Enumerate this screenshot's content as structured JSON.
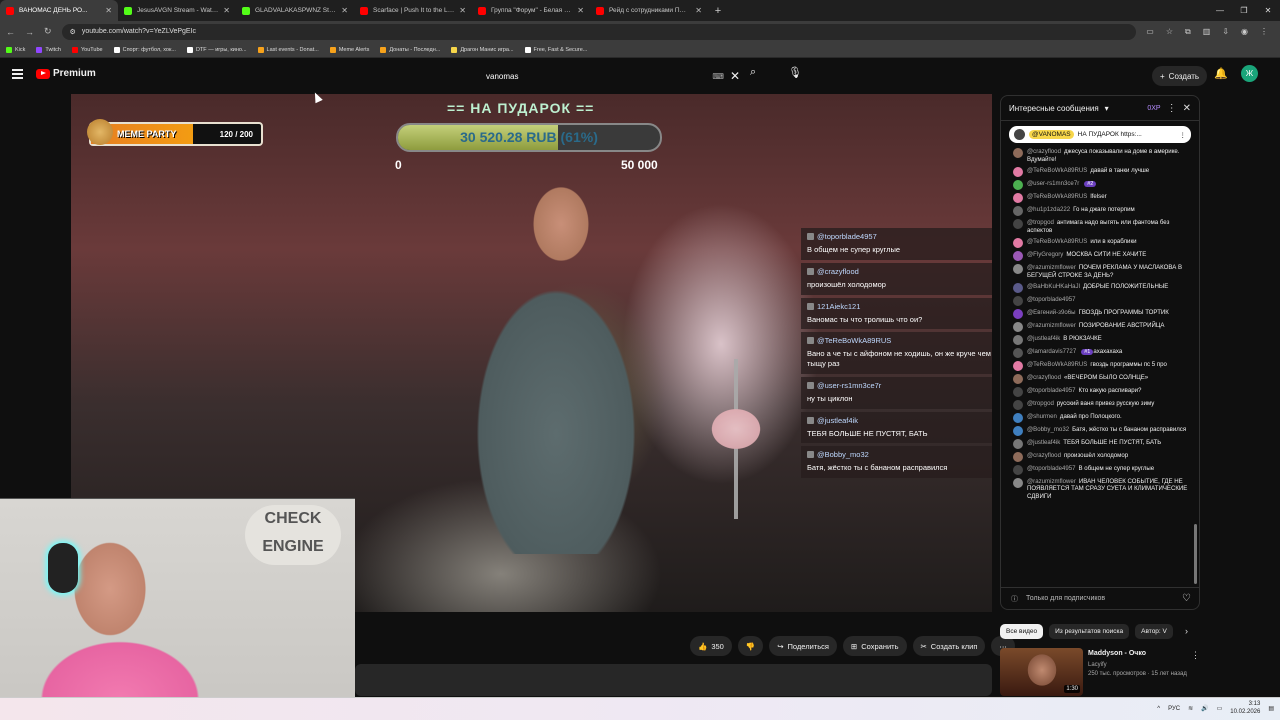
{
  "browser": {
    "tabs": [
      {
        "title": "ВАНОМАС ДЕНЬ РО...",
        "fav_color": "#ff0000",
        "active": true
      },
      {
        "title": "JesusAVGN Stream - Watch Live",
        "fav_color": "#53fc18",
        "active": false
      },
      {
        "title": "GLADVALAKASPWNZ Stream",
        "fav_color": "#53fc18",
        "active": false
      },
      {
        "title": "Scarface | Push It to the Limit",
        "fav_color": "#ff0000",
        "active": false
      },
      {
        "title": "Группа \"Форум\" - Белая ноч",
        "fav_color": "#ff0000",
        "active": false
      },
      {
        "title": "Рейд с сотрудниками ППСП",
        "fav_color": "#ff0000",
        "active": false
      }
    ],
    "url": "youtube.com/watch?v=YeZLVePgEIc",
    "bookmarks": [
      {
        "label": "Kick",
        "color": "#53fc18"
      },
      {
        "label": "Twitch",
        "color": "#9146ff"
      },
      {
        "label": "YouTube",
        "color": "#ff0000"
      },
      {
        "label": "Спорт: футбол, хок...",
        "color": "#ffffff"
      },
      {
        "label": "DTF — игры, кино...",
        "color": "#ffffff"
      },
      {
        "label": "Last events - Donat...",
        "color": "#f7a21b"
      },
      {
        "label": "Meme Alerts",
        "color": "#f7a21b"
      },
      {
        "label": "Донаты - Последн...",
        "color": "#f7a21b"
      },
      {
        "label": "Драгон Манис игра...",
        "color": "#f7d64a"
      },
      {
        "label": "Free, Fast & Secure...",
        "color": "#ffffff"
      }
    ]
  },
  "yt": {
    "logo_text": "Premium",
    "search_value": "vanomas",
    "create_label": "Создать",
    "avatar_letter": "Ж"
  },
  "video": {
    "meme_party": {
      "label": "MEME PARTY",
      "counter": "120 / 200",
      "progress": 0.6
    },
    "donation": {
      "title": "== НА ПУДАРОК ==",
      "amount": "30 520.28 RUB (61%)",
      "progress": 0.61,
      "min": "0",
      "max": "50 000"
    },
    "sign_text": "CHECK ENGINE",
    "chat": [
      {
        "name": "@toporblade4957",
        "text": "В общем не супер круглые"
      },
      {
        "name": "@crazyflood",
        "text": "произошёл холодомор"
      },
      {
        "name": "121Aiekc121",
        "text": "Ваномас ты что тролишь что ои?"
      },
      {
        "name": "@TeReBoWkA89RUS",
        "text": "Вано а че ты с айфоном не ходишь, он же круче чем это хуевей в тыщу раз"
      },
      {
        "name": "@user-rs1mn3ce7r",
        "text": "ну ты циклон"
      },
      {
        "name": "@justleaf4ik",
        "text": "ТЕБЯ БОЛЬШЕ НЕ ПУСТЯТ, БАТЬ"
      },
      {
        "name": "@Bobby_mo32",
        "text": "Батя, жёстко ты с бананом расправился"
      }
    ]
  },
  "actions": {
    "likes": "350",
    "share": "Поделиться",
    "save": "Сохранить",
    "clip": "Создать клип"
  },
  "chat": {
    "header": "Интересные сообщения",
    "xp": "0XP",
    "pinned_author": "@VANOMAS",
    "pinned_text": "НА ПУДАРОК https:...",
    "messages": [
      {
        "author": "@crazyflood",
        "text": "джесуса показывали на доме в америке. Вдумайте!",
        "color": "#8e6b5a"
      },
      {
        "author": "@TeReBoWkA89RUS",
        "text": "давай в танки лучше",
        "color": "#e27aa4"
      },
      {
        "author": "@user-rs1mn3ce7r",
        "text": "",
        "badge": "#2",
        "color": "#4caf50"
      },
      {
        "author": "@TeReBoWkA89RUS",
        "text": "lfelser",
        "color": "#e27aa4"
      },
      {
        "author": "@hu1p1zda222",
        "text": "Го на джаге потерпим",
        "color": "#666666"
      },
      {
        "author": "@tropgod",
        "text": "антимага надо выгять или фантома без аспектов",
        "color": "#444444"
      },
      {
        "author": "@TeReBoWkA89RUS",
        "text": "или в кораблики",
        "color": "#e27aa4"
      },
      {
        "author": "@FlyGregory",
        "text": "МОСКВА СИТИ НЕ ХАЧИТЕ",
        "color": "#9b59b6"
      },
      {
        "author": "@razumizmflower",
        "text": "ПОЧЕМ РЕКЛАМА У МАСЛАКОВА В БЕГУЩЕЙ СТРОКЕ ЗА ДЕНЬ?",
        "color": "#888888"
      },
      {
        "author": "@BaHbKuHKaHaJl",
        "text": "ДОБРЫЕ ПОЛОЖИТЕЛЬНЫЕ",
        "color": "#5a5a8a"
      },
      {
        "author": "@toporblade4957",
        "text": "",
        "color": "#444444"
      },
      {
        "author": "@Евгений-з9о6ы",
        "text": "ГВОЗДЬ ПРОГРАММЫ ТОРТИК",
        "color": "#7b3fbf"
      },
      {
        "author": "@razumizmflower",
        "text": "ПОЗИРОВАНИЕ АВСТРИЙЦА",
        "color": "#888888"
      },
      {
        "author": "@justleaf4ik",
        "text": "В РЮКЗАЧКЕ",
        "color": "#777777"
      },
      {
        "author": "@lamardavis7727",
        "text": "ахахахаха",
        "badge": "#1",
        "color": "#555555"
      },
      {
        "author": "@TeReBoWkA89RUS",
        "text": "гвоздь программы пс 5 про",
        "color": "#e27aa4"
      },
      {
        "author": "@crazyflood",
        "text": "«ВЕЧЕРОМ БЫЛО СОЛНЦЕ»",
        "color": "#8e6b5a"
      },
      {
        "author": "@toporblade4957",
        "text": "Кто какую распивари?",
        "color": "#444444"
      },
      {
        "author": "@tropgod",
        "text": "русский ваня привез русскую зиму",
        "color": "#444444"
      },
      {
        "author": "@shurmen",
        "text": "давай про Полоцкого.",
        "color": "#3f7fbf"
      },
      {
        "author": "@Bobby_mo32",
        "text": "Батя, жёстко ты с бананом расправился",
        "color": "#3f7fbf"
      },
      {
        "author": "@justleaf4ik",
        "text": "ТЕБЯ БОЛЬШЕ НЕ ПУСТЯТ, БАТЬ",
        "color": "#777777"
      },
      {
        "author": "@crazyflood",
        "text": "произошёл холодомор",
        "color": "#8e6b5a"
      },
      {
        "author": "@toporblade4957",
        "text": "В общем не супер круглые",
        "color": "#444444"
      },
      {
        "author": "@razumizmflower",
        "text": "ИВАН ЧЕЛОВЕК СОБЫТИЕ, ГДЕ НЕ ПОЯВЛЯЕТСЯ ТАМ СРАЗУ СУЕТА И КЛИМАТИЧЕСКИЕ СДВИГИ",
        "color": "#888888"
      }
    ],
    "input_placeholder": "Только для подписчиков"
  },
  "recs": {
    "chips": [
      "Все видео",
      "Из результатов поиска",
      "Автор: V"
    ],
    "item": {
      "title": "Maddyson - Очко",
      "channel": "Lacyify",
      "meta": "250 тыс. просмотров · 15 лет назад",
      "duration": "1:30"
    }
  },
  "taskbar": {
    "lang": "РУС",
    "time": "3:13",
    "date": "10.02.2026"
  }
}
